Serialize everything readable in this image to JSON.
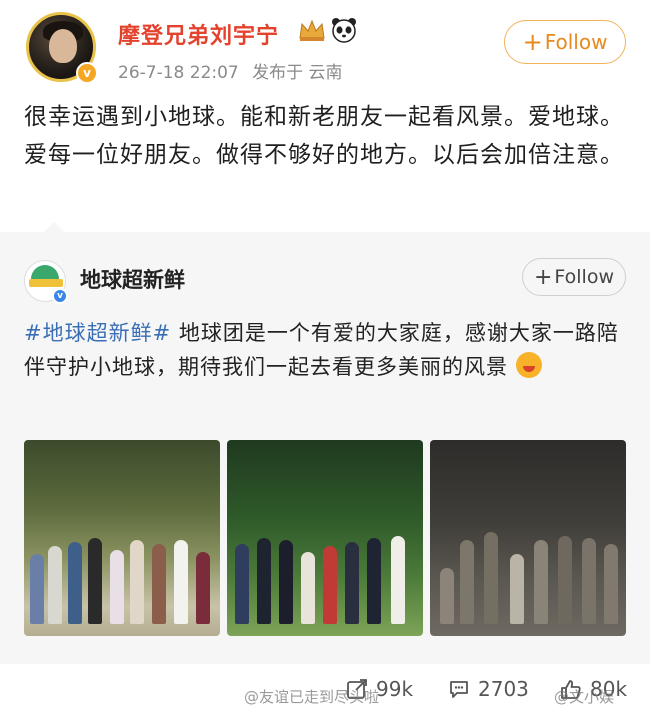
{
  "post": {
    "username": "摩登兄弟刘宇宁",
    "timestamp": "26-7-18 22:07",
    "posted_from": "发布于 云南",
    "follow_label": "Follow",
    "follow_plus": "+",
    "verified_icon": "v-badge-orange",
    "text": "很幸运遇到小地球。能和新老朋友一起看风景。爱地球。爱每一位好朋友。做得不够好的地方。以后会加倍注意。"
  },
  "repost": {
    "username": "地球超新鲜",
    "follow_label": "Follow",
    "follow_plus": "+",
    "hashtag": "#地球超新鲜#",
    "text": " 地球团是一个有爱的大家庭，感谢大家一路陪伴守护小地球，期待我们一起去看更多美丽的风景",
    "images": [
      "group-photo-forest",
      "group-photo-costumes",
      "group-photo-mud"
    ]
  },
  "actions": {
    "share_count": "99k",
    "comment_count": "2703",
    "like_count": "80k"
  },
  "watermarks": {
    "left": "@友谊已走到尽头啦",
    "right": "@文小娱"
  },
  "colors": {
    "username": "#e3422d",
    "follow_border": "#f0b35a",
    "follow_text": "#e8891e",
    "hashtag": "#3a6fb5",
    "repost_bg": "#f6f6f6"
  }
}
